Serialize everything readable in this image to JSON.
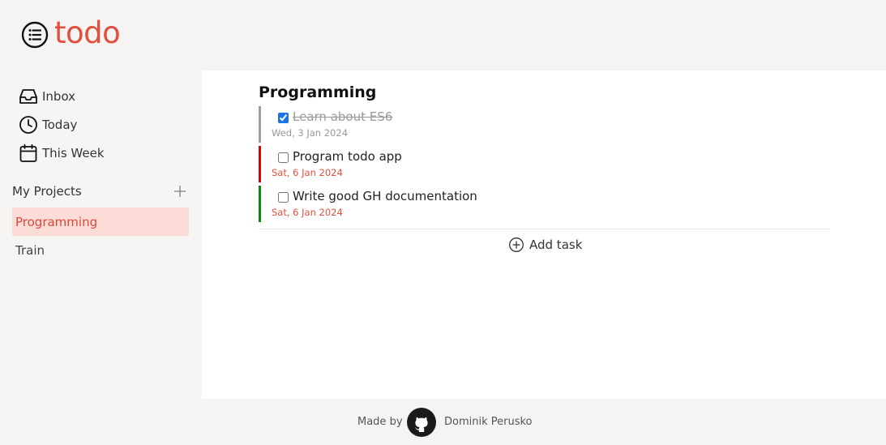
{
  "app": {
    "name": "todo",
    "accent": "#e0503f"
  },
  "nav": {
    "items": [
      {
        "label": "Inbox",
        "icon": "inbox-icon"
      },
      {
        "label": "Today",
        "icon": "clock-icon"
      },
      {
        "label": "This Week",
        "icon": "calendar-icon"
      }
    ]
  },
  "projects": {
    "title": "My Projects",
    "add_icon": "plus-icon",
    "items": [
      {
        "label": "Programming",
        "active": true
      },
      {
        "label": "Train",
        "active": false
      }
    ]
  },
  "main": {
    "project_title": "Programming",
    "tasks": [
      {
        "title": "Learn about ES6",
        "date": "Wed, 3 Jan 2024",
        "completed": true,
        "priority_color": "#9e9e9e"
      },
      {
        "title": "Program todo app",
        "date": "Sat, 6 Jan 2024",
        "completed": false,
        "priority_color": "#e00000"
      },
      {
        "title": "Write good GH documentation",
        "date": "Sat, 6 Jan 2024",
        "completed": false,
        "priority_color": "#0a8a0a"
      }
    ],
    "add_task_label": "Add task"
  },
  "footer": {
    "made_by": "Made by",
    "author": "Dominik Perusko",
    "icon": "github-icon"
  }
}
